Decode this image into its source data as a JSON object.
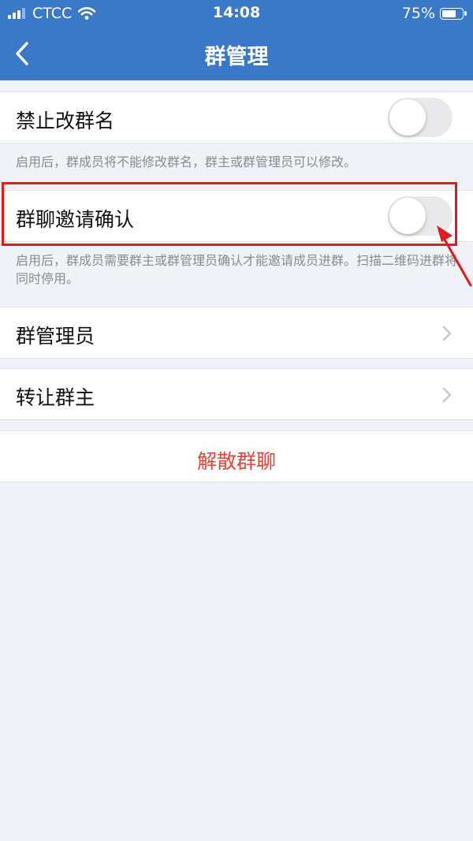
{
  "status_bar": {
    "carrier": "CTCC",
    "time": "14:08",
    "battery": "75%",
    "battery_level": 0.75
  },
  "nav": {
    "title": "群管理",
    "back_icon": "chevron-left-icon"
  },
  "settings": {
    "forbid_rename": {
      "label": "禁止改群名",
      "enabled": false,
      "hint": "启用后，群成员将不能修改群名，群主或群管理员可以修改。"
    },
    "invite_confirm": {
      "label": "群聊邀请确认",
      "enabled": false,
      "hint": "启用后，群成员需要群主或群管理员确认才能邀请成员进群。扫描二维码进群将同时停用。"
    },
    "admins": {
      "label": "群管理员"
    },
    "transfer_owner": {
      "label": "转让群主"
    },
    "dissolve": {
      "label": "解散群聊"
    }
  },
  "colors": {
    "header_blue": "#3a78c8",
    "danger_red": "#e4443a",
    "annotation_red": "#e01c1c",
    "background": "#f1f2f7"
  }
}
